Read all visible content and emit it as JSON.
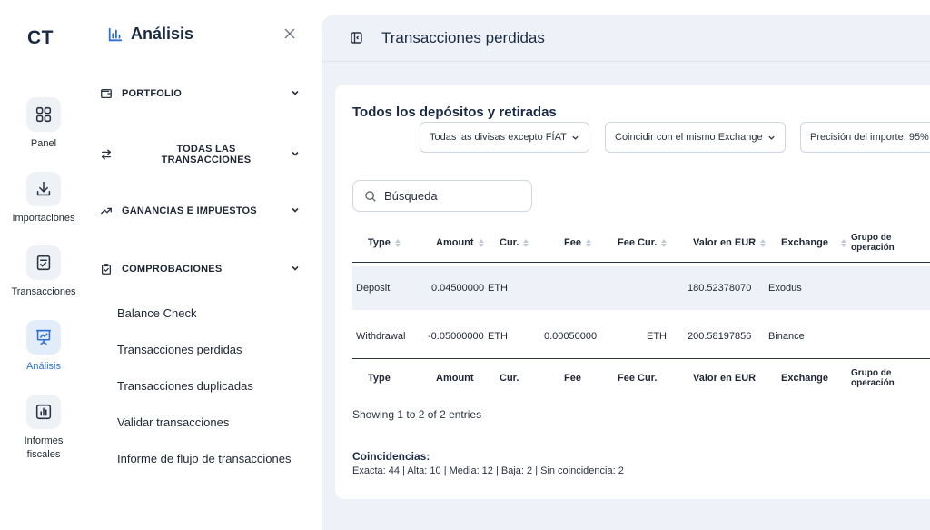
{
  "app": {
    "logo": "CT"
  },
  "rail": {
    "items": [
      {
        "label": "Panel",
        "icon": "grid-icon"
      },
      {
        "label": "Importaciones",
        "icon": "download-icon"
      },
      {
        "label": "Transacciones",
        "icon": "checklist-icon"
      },
      {
        "label": "Análisis",
        "icon": "presentation-chart-icon",
        "active": true
      },
      {
        "label": "Informes\nfiscales",
        "icon": "bar-chart-icon"
      }
    ]
  },
  "subnav": {
    "title": "Análisis",
    "sections": [
      {
        "label": "PORTFOLIO",
        "icon": "wallet-icon"
      },
      {
        "label": "TODAS LAS\nTRANSACCIONES",
        "icon": "transfer-arrows-icon"
      },
      {
        "label": "GANANCIAS E IMPUESTOS",
        "icon": "trend-up-icon"
      },
      {
        "label": "COMPROBACIONES",
        "icon": "clipboard-check-icon"
      }
    ],
    "links": [
      "Balance Check",
      "Transacciones perdidas",
      "Transacciones duplicadas",
      "Validar transacciones",
      "Informe de flujo de transacciones"
    ]
  },
  "page": {
    "title": "Transacciones perdidas"
  },
  "card": {
    "title": "Todos los depósitos y retiradas",
    "filters": [
      "Todas las divisas excepto FÍAT",
      "Coincidir con el mismo Exchange",
      "Precisión del importe: 95%"
    ],
    "search": {
      "placeholder": "Búsqueda",
      "value": ""
    }
  },
  "table": {
    "columns": [
      "Type",
      "Amount",
      "Cur.",
      "Fee",
      "Fee Cur.",
      "Valor en EUR",
      "Exchange",
      "Grupo de\noperación"
    ],
    "rows": [
      {
        "type": "Deposit",
        "amount": "0.04500000",
        "cur": "ETH",
        "fee": "",
        "fee_cur": "",
        "valor": "180.52378070",
        "exchange": "Exodus",
        "grupo": ""
      },
      {
        "type": "Withdrawal",
        "amount": "-0.05000000",
        "cur": "ETH",
        "fee": "0.00050000",
        "fee_cur": "ETH",
        "valor": "200.58197856",
        "exchange": "Binance",
        "grupo": ""
      }
    ],
    "info": "Showing 1 to 2 of 2 entries"
  },
  "matches": {
    "title": "Coincidencias:",
    "summary": "Exacta: 44 | Alta: 10 | Media: 12 | Baja: 2 | Sin coincidencia: 2"
  },
  "colors": {
    "accent": "#2f6fd6",
    "main_bg": "#eef2f8",
    "text": "#1f2633"
  }
}
